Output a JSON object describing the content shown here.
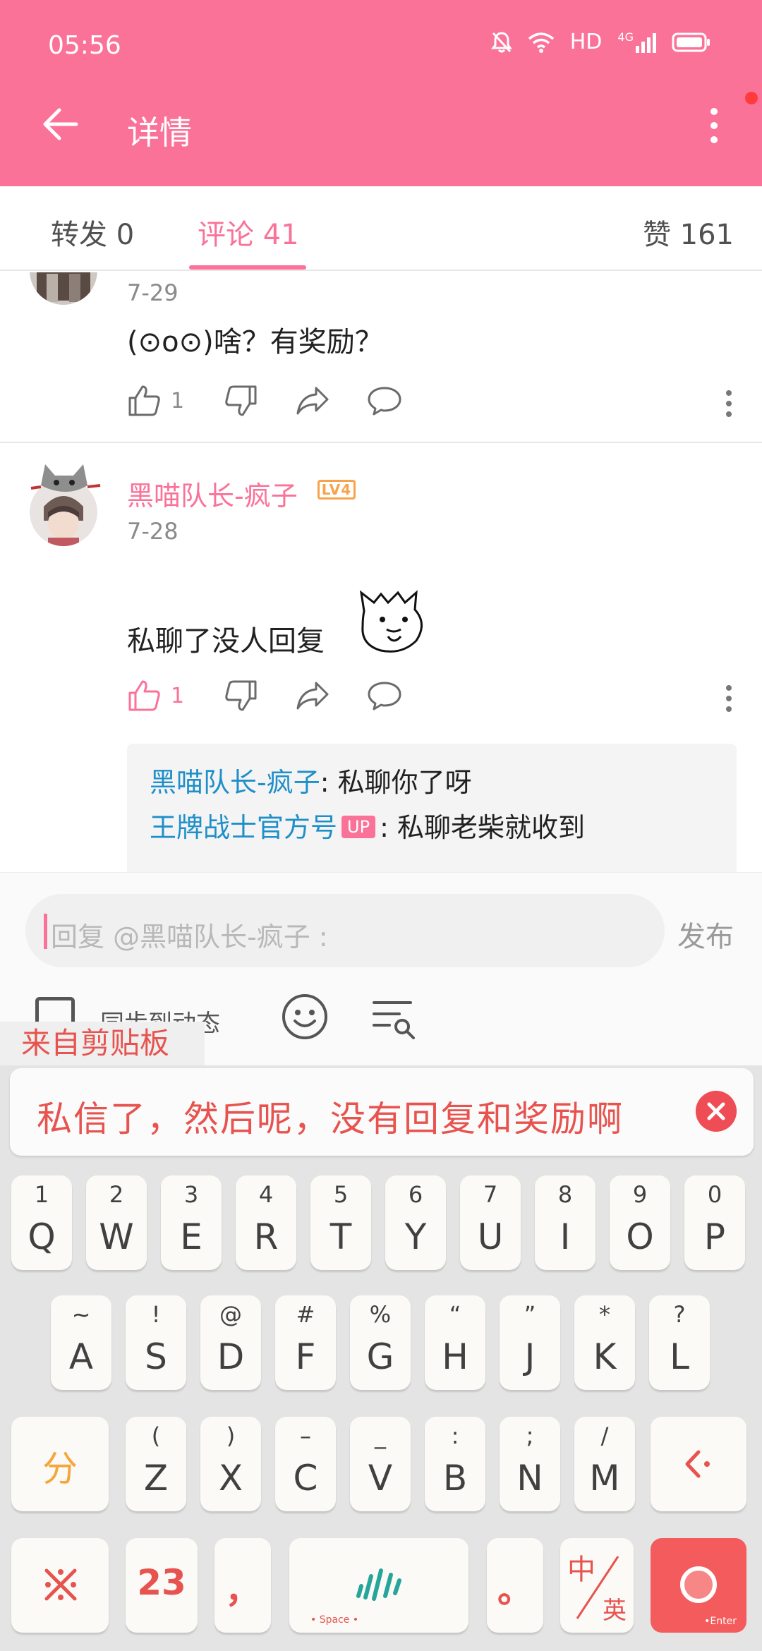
{
  "status_bar": {
    "time": "05:56",
    "hd": "HD",
    "network": "4G"
  },
  "header": {
    "title": "详情"
  },
  "tabs": [
    {
      "label": "转发 0"
    },
    {
      "label": "评论 41"
    },
    {
      "label": "赞 161"
    }
  ],
  "comments": [
    {
      "date": "7-29",
      "text": "(⊙o⊙)啥？有奖励？",
      "likes": "1"
    },
    {
      "username": "黑喵队长-疯子",
      "level": "LV4",
      "date": "7-28",
      "text": "私聊了没人回复",
      "likes": "1",
      "replies": [
        {
          "name": "黑喵队长-疯子",
          "text": ": 私聊你了呀"
        },
        {
          "name": "王牌战士官方号",
          "badge": "UP",
          "text": ": 私聊老柴就收到"
        }
      ]
    }
  ],
  "reply_bar": {
    "placeholder": "回复 @黑喵队长-疯子 :",
    "publish": "发布",
    "sync_label": "同步到动态"
  },
  "clipboard": {
    "label": "来自剪贴板",
    "text": "私信了，然后呢，没有回复和奖励啊"
  },
  "keyboard": {
    "row1": [
      {
        "sub": "1",
        "main": "Q"
      },
      {
        "sub": "2",
        "main": "W"
      },
      {
        "sub": "3",
        "main": "E"
      },
      {
        "sub": "4",
        "main": "R"
      },
      {
        "sub": "5",
        "main": "T"
      },
      {
        "sub": "6",
        "main": "Y"
      },
      {
        "sub": "7",
        "main": "U"
      },
      {
        "sub": "8",
        "main": "I"
      },
      {
        "sub": "9",
        "main": "O"
      },
      {
        "sub": "0",
        "main": "P"
      }
    ],
    "row2": [
      {
        "sub": "~",
        "main": "A"
      },
      {
        "sub": "!",
        "main": "S"
      },
      {
        "sub": "@",
        "main": "D"
      },
      {
        "sub": "#",
        "main": "F"
      },
      {
        "sub": "%",
        "main": "G"
      },
      {
        "sub": "“",
        "main": "H"
      },
      {
        "sub": "”",
        "main": "J"
      },
      {
        "sub": "*",
        "main": "K"
      },
      {
        "sub": "?",
        "main": "L"
      }
    ],
    "row3_left": "分",
    "row3": [
      {
        "sub": "(",
        "main": "Z"
      },
      {
        "sub": ")",
        "main": "X"
      },
      {
        "sub": "–",
        "main": "C"
      },
      {
        "sub": "_",
        "main": "V"
      },
      {
        "sub": ":",
        "main": "B"
      },
      {
        "sub": ";",
        "main": "N"
      },
      {
        "sub": "/",
        "main": "M"
      }
    ],
    "row4": {
      "k123": "23",
      "comma": "，",
      "space_label": "• Space •",
      "period": "。",
      "lang_top": "中",
      "lang_bottom": "英",
      "enter_label": "•Enter"
    }
  }
}
